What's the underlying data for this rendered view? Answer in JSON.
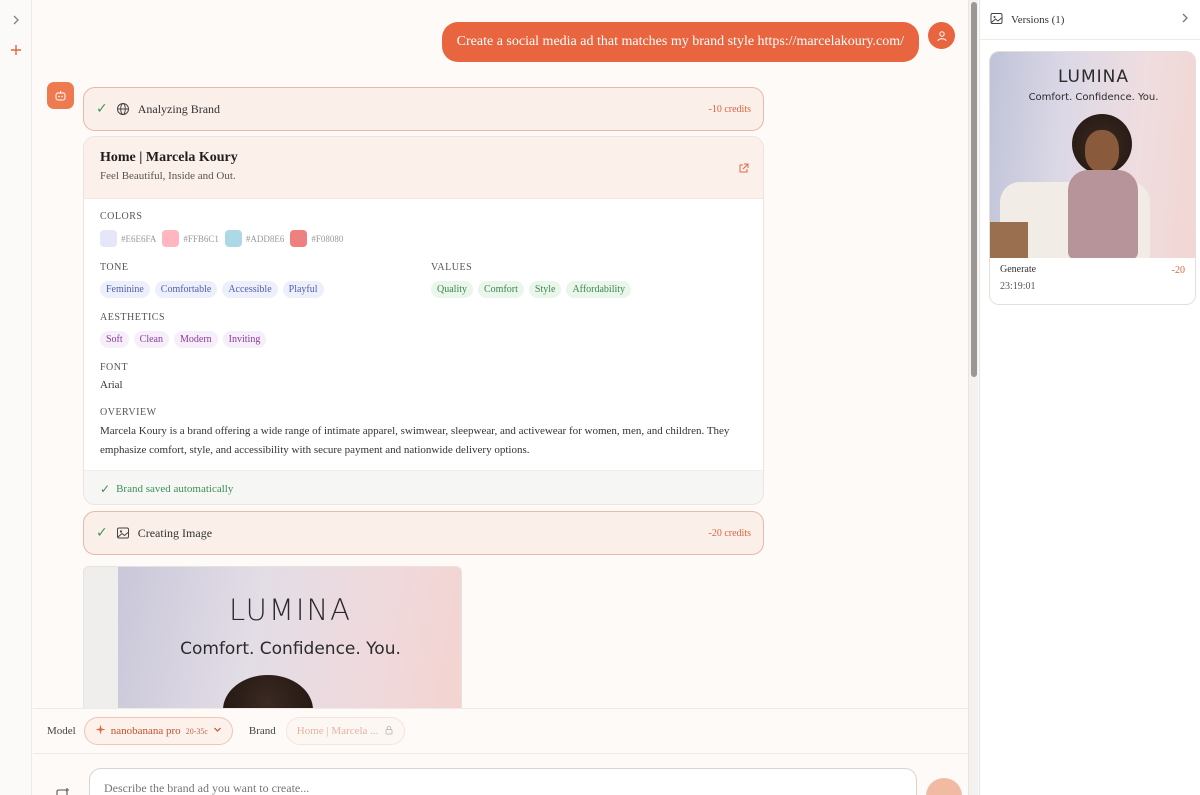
{
  "rail": {
    "expand_icon": "chevron-right-icon",
    "new_icon": "plus-icon"
  },
  "chat": {
    "user_message": "Create a social media ad that matches my brand style https://marcelakoury.com/",
    "step_analyze": {
      "title": "Analyzing Brand",
      "credits": "-10 credits"
    },
    "brand": {
      "name": "Home | Marcela Koury",
      "tagline": "Feel Beautiful, Inside and Out.",
      "colors_label": "COLORS",
      "colors": [
        {
          "hex": "#E6E6FA",
          "swatch": "#E6E6FA"
        },
        {
          "hex": "#FFB6C1",
          "swatch": "#FFB6C1"
        },
        {
          "hex": "#ADD8E6",
          "swatch": "#ADD8E6"
        },
        {
          "hex": "#F08080",
          "swatch": "#F08080"
        }
      ],
      "tone_label": "TONE",
      "tone": [
        "Feminine",
        "Comfortable",
        "Accessible",
        "Playful"
      ],
      "values_label": "VALUES",
      "values": [
        "Quality",
        "Comfort",
        "Style",
        "Affordability"
      ],
      "aesthetics_label": "AESTHETICS",
      "aesthetics": [
        "Soft",
        "Clean",
        "Modern",
        "Inviting"
      ],
      "font_label": "FONT",
      "font": "Arial",
      "overview_label": "OVERVIEW",
      "overview": "Marcela Koury is a brand offering a wide range of intimate apparel, swimwear, sleepwear, and activewear for women, men, and children. They emphasize comfort, style, and accessibility with secure payment and nationwide delivery options.",
      "saved": "Brand saved automatically"
    },
    "step_image": {
      "title": "Creating Image",
      "credits": "-20 credits"
    },
    "ad": {
      "brand": "LUMINA",
      "tagline": "Comfort. Confidence. You."
    }
  },
  "toolbar": {
    "model_label": "Model",
    "model_name": "nanobanana pro",
    "model_cost": "20-35c",
    "brand_label": "Brand",
    "brand_value": "Home | Marcela ..."
  },
  "composer": {
    "placeholder": "Describe the brand ad you want to create..."
  },
  "panel": {
    "title": "Versions (1)",
    "version": {
      "brand": "LUMINA",
      "tagline": "Comfort. Confidence. You.",
      "action": "Generate",
      "cost": "-20",
      "time": "23:19:01"
    }
  },
  "accent": "#E8653F"
}
